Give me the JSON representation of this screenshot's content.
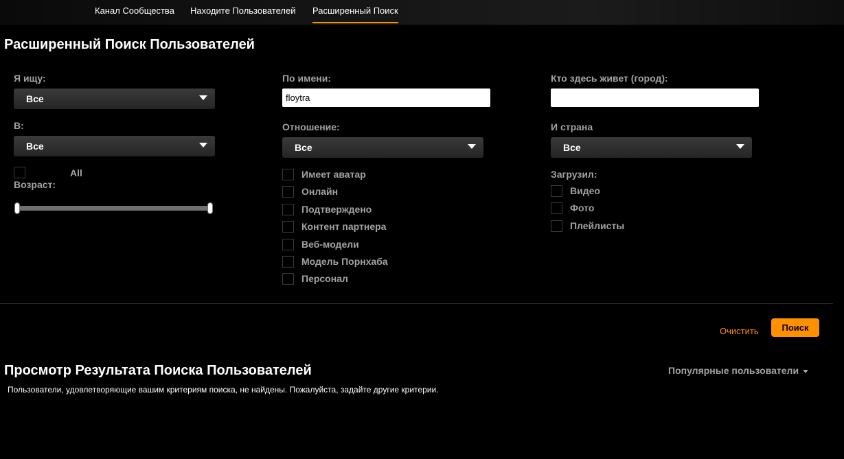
{
  "nav": {
    "tabs": [
      {
        "label": "Канал Сообщества"
      },
      {
        "label": "Находите Пользователей"
      },
      {
        "label": "Расширенный Поиск",
        "active": true
      }
    ],
    "accent_color": "#ff9000"
  },
  "search_form": {
    "title": "Расширенный Поиск Пользователей",
    "looking_for": {
      "label": "Я ищу:",
      "selected": "Все"
    },
    "in": {
      "label": "В:",
      "selected": "Все"
    },
    "age": {
      "all_checkbox_label": "All",
      "label": "Возраст:",
      "slider_min": 0.0,
      "slider_max": 1.0
    },
    "by_name": {
      "label": "По имени:",
      "value": "floytra",
      "placeholder": ""
    },
    "relationship": {
      "label": "Отношение:",
      "selected": "Все"
    },
    "filters": [
      {
        "label": "Имеет аватар",
        "checked": false
      },
      {
        "label": "Онлайн",
        "checked": false
      },
      {
        "label": "Подтверждено",
        "checked": false
      },
      {
        "label": "Контент партнера",
        "checked": false
      },
      {
        "label": "Веб-модели",
        "checked": false
      },
      {
        "label": "Модель Порнхаба",
        "checked": false
      },
      {
        "label": "Персонал",
        "checked": false
      }
    ],
    "city": {
      "label": "Кто здесь живет (город):",
      "value": ""
    },
    "country": {
      "label": "И страна",
      "selected": "Все"
    },
    "uploaded": {
      "label": "Загрузил:",
      "items": [
        {
          "label": "Видео",
          "checked": false
        },
        {
          "label": "Фото",
          "checked": false
        },
        {
          "label": "Плейлисты",
          "checked": false
        }
      ]
    },
    "clear_label": "Очистить",
    "search_label": "Поиск"
  },
  "results": {
    "title": "Просмотр Результата Поиска Пользователей",
    "sort_label": "Популярные пользователи",
    "empty_message": "Пользователи, удовлетворяющие вашим критериям поиска, не найдены. Пожалуйста, задайте другие критерии."
  }
}
